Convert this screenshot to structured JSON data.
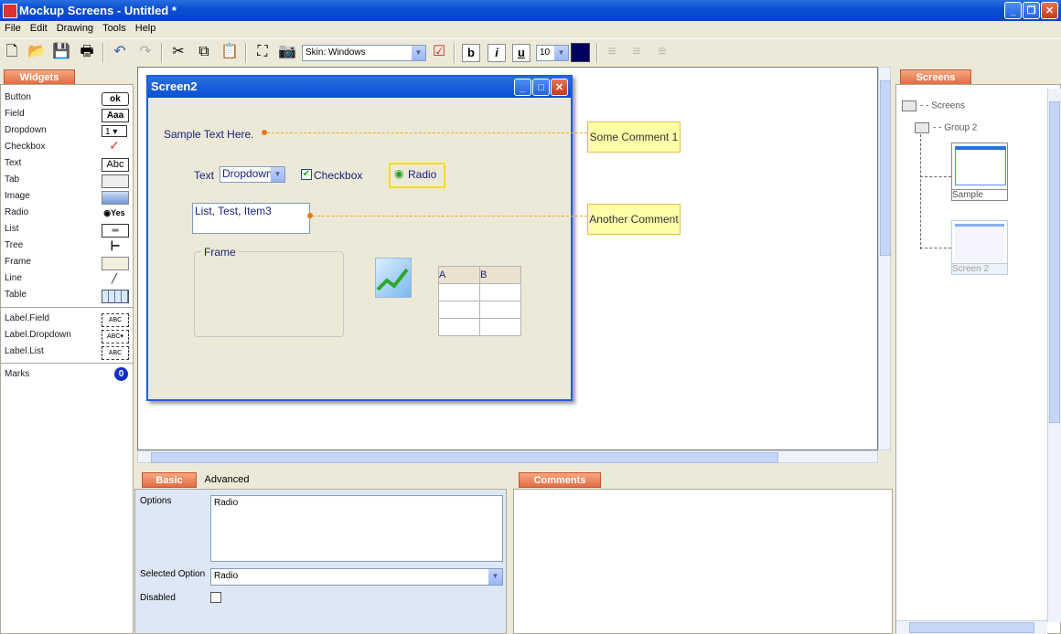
{
  "title": "Mockup Screens - Untitled *",
  "menu": [
    "File",
    "Edit",
    "Drawing",
    "Tools",
    "Help"
  ],
  "toolbar": {
    "skin": "Skin: Windows",
    "font_size": "10",
    "bold": "b",
    "italic": "i",
    "underline": "u"
  },
  "widgets_tab": "Widgets",
  "widgets": [
    {
      "label": "Button",
      "icon": "ok"
    },
    {
      "label": "Field",
      "icon": "Aaa"
    },
    {
      "label": "Dropdown",
      "icon": "1"
    },
    {
      "label": "Checkbox",
      "icon": ""
    },
    {
      "label": "Text",
      "icon": "Abc"
    },
    {
      "label": "Tab",
      "icon": ""
    },
    {
      "label": "Image",
      "icon": ""
    },
    {
      "label": "Radio",
      "icon": "Yes"
    },
    {
      "label": "List",
      "icon": ""
    },
    {
      "label": "Tree",
      "icon": ""
    },
    {
      "label": "Frame",
      "icon": ""
    },
    {
      "label": "Line",
      "icon": ""
    },
    {
      "label": "Table",
      "icon": ""
    }
  ],
  "label_widgets": [
    "Label.Field",
    "Label.Dropdown",
    "Label.List"
  ],
  "marks": {
    "label": "Marks",
    "count": "0"
  },
  "screen": {
    "title": "Screen2",
    "sample_text": "Sample Text Here.",
    "text_label": "Text",
    "dropdown": "Dropdown",
    "checkbox": "Checkbox",
    "radio": "Radio",
    "list": "List, Test, Item3",
    "frame": "Frame",
    "table_headers": [
      "A",
      "B"
    ]
  },
  "comments_on_canvas": [
    "Some Comment 1",
    "Another Comment"
  ],
  "props_tabs": [
    "Basic",
    "Advanced"
  ],
  "props": {
    "options_label": "Options",
    "options_value": "Radio",
    "selected_label": "Selected Option",
    "selected_value": "Radio",
    "disabled_label": "Disabled"
  },
  "comments_tab": "Comments",
  "screens_tab": "Screens",
  "tree": {
    "root": "Screens",
    "group": "Group 2",
    "thumbs": [
      "Sample",
      "Screen 2"
    ]
  }
}
